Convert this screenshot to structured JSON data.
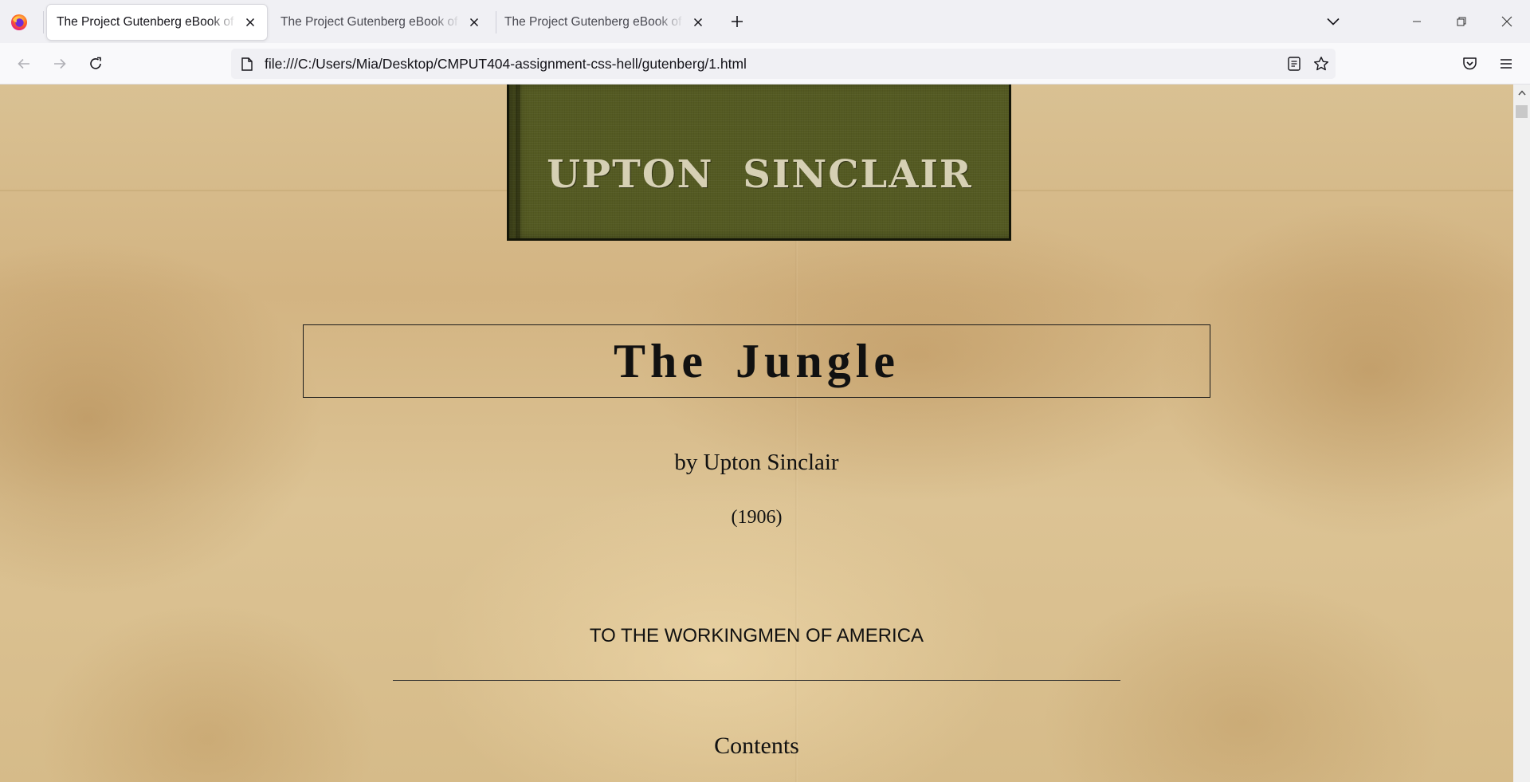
{
  "browser": {
    "tabs": [
      {
        "title": "The Project Gutenberg eBook of The Jungle",
        "active": true
      },
      {
        "title": "The Project Gutenberg eBook of The Jungle",
        "active": false
      },
      {
        "title": "The Project Gutenberg eBook of The Jungle",
        "active": false
      }
    ],
    "url": "file:///C:/Users/Mia/Desktop/CMPUT404-assignment-css-hell/gutenberg/1.html",
    "icons": {
      "logo": "firefox-logo-icon",
      "new_tab": "plus-icon",
      "tab_list": "chevron-down-icon",
      "back": "arrow-left-icon",
      "forward": "arrow-right-icon",
      "reload": "reload-icon",
      "page": "page-icon",
      "reader": "reader-view-icon",
      "bookmark": "star-icon",
      "pocket": "pocket-icon",
      "menu": "hamburger-menu-icon"
    }
  },
  "page": {
    "cover_author": "UPTON SINCLAIR",
    "title": "The Jungle",
    "byline": "by Upton Sinclair",
    "year": "(1906)",
    "dedication": "TO THE WORKINGMEN OF AMERICA",
    "contents_heading": "Contents"
  },
  "colors": {
    "cover_green": "#545a22",
    "parchment": "#d6bb89",
    "text": "#111111"
  }
}
